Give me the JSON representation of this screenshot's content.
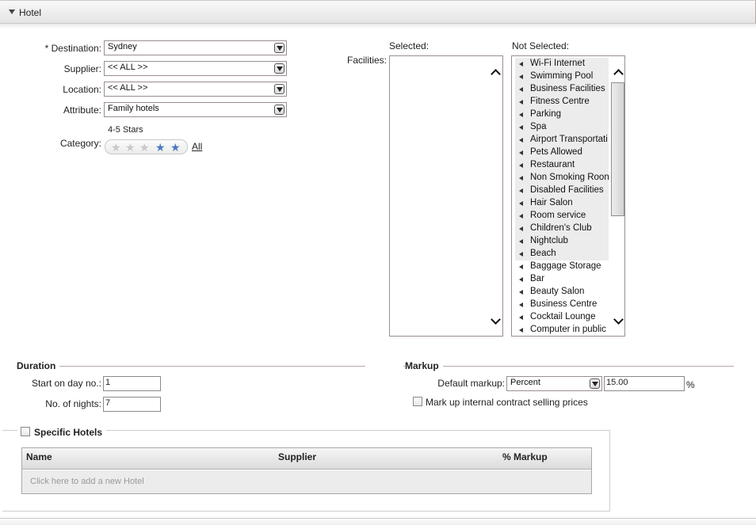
{
  "panel": {
    "title": "Hotel"
  },
  "criteria": {
    "destination_label": "* Destination:",
    "destination_value": "Sydney",
    "supplier_label": "Supplier:",
    "supplier_value": "<< ALL >>",
    "location_label": "Location:",
    "location_value": "<< ALL >>",
    "attribute_label": "Attribute:",
    "attribute_value": "Family hotels",
    "category_label": "Category:",
    "category_rating_text": "4-5 Stars",
    "category_all_link": "All",
    "category_min_stars": 4,
    "category_max_stars": 5,
    "category_total_stars": 5
  },
  "facilities": {
    "label": "Facilities:",
    "selected_header": "Selected:",
    "not_selected_header": "Not Selected:",
    "selected_items": [],
    "not_selected_items": [
      "Wi-Fi Internet",
      "Swimming Pool",
      "Business Facilities",
      "Fitness Centre",
      "Parking",
      "Spa",
      "Airport Transportati",
      "Pets Allowed",
      "Restaurant",
      "Non Smoking Roon",
      "Disabled Facilities",
      "Hair Salon",
      "Room service",
      "Children's Club",
      "Nightclub",
      "Beach",
      "Baggage Storage",
      "Bar",
      "Beauty Salon",
      "Business Centre",
      "Cocktail Lounge",
      "Computer in public"
    ],
    "highlighted_count": 16
  },
  "duration": {
    "legend": "Duration",
    "start_label": "Start on day no.:",
    "start_value": "1",
    "nights_label": "No. of nights:",
    "nights_value": "7"
  },
  "markup": {
    "legend": "Markup",
    "default_label": "Default markup:",
    "type_value": "Percent",
    "amount_value": "15.00",
    "unit": "%",
    "internal_label": "Mark up internal contract selling prices",
    "internal_checked": false
  },
  "specific_hotels": {
    "label": "Specific Hotels",
    "checked": false,
    "columns": [
      "Name",
      "Supplier",
      "% Markup"
    ],
    "add_row_text": "Click here to add a new Hotel"
  }
}
